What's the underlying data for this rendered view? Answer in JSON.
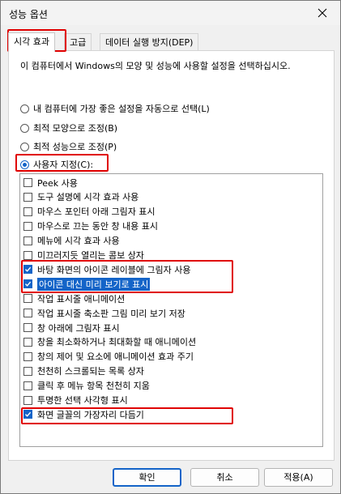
{
  "window": {
    "title": "성능 옵션"
  },
  "tabs": [
    {
      "label": "시각 효과"
    },
    {
      "label": "고급"
    },
    {
      "label": "데이터 실행 방지(DEP)"
    }
  ],
  "description": "이 컴퓨터에서 Windows의 모양 및 성능에 사용할 설정을 선택하십시오.",
  "options": [
    {
      "label": "내 컴퓨터에 가장 좋은 설정을 자동으로 선택(L)",
      "checked": false
    },
    {
      "label": "최적 모양으로 조정(B)",
      "checked": false
    },
    {
      "label": "최적 성능으로 조정(P)",
      "checked": false
    },
    {
      "label": "사용자 지정(C):",
      "checked": true
    }
  ],
  "effects": [
    {
      "label": "Peek 사용",
      "checked": false
    },
    {
      "label": "도구 설명에 시각 효과 사용",
      "checked": false
    },
    {
      "label": "마우스 포인터 아래 그림자 표시",
      "checked": false
    },
    {
      "label": "마우스로 끄는 동안 창 내용 표시",
      "checked": false
    },
    {
      "label": "메뉴에 시각 효과 사용",
      "checked": false
    },
    {
      "label": "미끄러지듯 열리는 콤보 상자",
      "checked": false
    },
    {
      "label": "바탕 화면의 아이콘 레이블에 그림자 사용",
      "checked": true
    },
    {
      "label": "아이콘 대신 미리 보기로 표시",
      "checked": true,
      "selected": true
    },
    {
      "label": "작업 표시줄 애니메이션",
      "checked": false
    },
    {
      "label": "작업 표시줄 축소판 그림 미리 보기 저장",
      "checked": false
    },
    {
      "label": "창 아래에 그림자 표시",
      "checked": false
    },
    {
      "label": "창을 최소화하거나 최대화할 때 애니메이션",
      "checked": false
    },
    {
      "label": "창의 제어 및 요소에 애니메이션 효과 주기",
      "checked": false
    },
    {
      "label": "천천히 스크롤되는 목록 상자",
      "checked": false
    },
    {
      "label": "클릭 후 메뉴 항목 천천히 지움",
      "checked": false
    },
    {
      "label": "투명한 선택 사각형 표시",
      "checked": false
    },
    {
      "label": "화면 글꼴의 가장자리 다듬기",
      "checked": true
    }
  ],
  "buttons": {
    "ok": "확인",
    "cancel": "취소",
    "apply": "적용(A)"
  },
  "colors": {
    "accent": "#1464c8",
    "highlight": "#e00000"
  }
}
